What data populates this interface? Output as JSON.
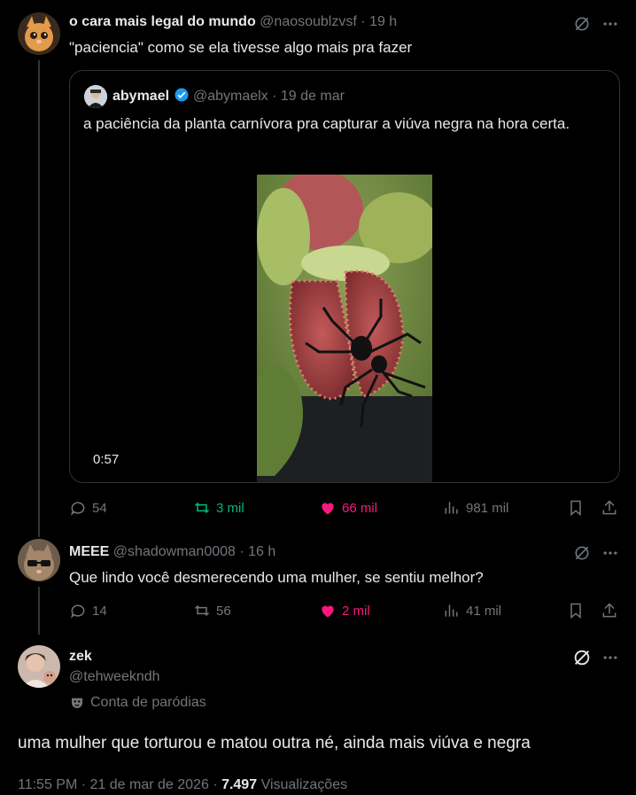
{
  "post1": {
    "display_name": "o cara mais legal do mundo",
    "handle": "@naosoublzvsf",
    "time": "· 19 h",
    "text": "\"paciencia\" como se ela tivesse algo mais pra fazer",
    "quote": {
      "display_name": "abymael",
      "handle": "@abymaelx",
      "time": "· 19 de mar",
      "text": "a paciência da planta carnívora pra capturar a viúva negra na hora certa.",
      "video_duration": "0:57"
    },
    "stats": {
      "replies": "54",
      "reposts": "3 mil",
      "likes": "66 mil",
      "views": "981 mil"
    }
  },
  "post2": {
    "display_name": "MEEE",
    "handle": "@shadowman0008",
    "time": "· 16 h",
    "text": "Que lindo você desmerecendo uma mulher, se sentiu melhor?",
    "stats": {
      "replies": "14",
      "reposts": "56",
      "likes": "2 mil",
      "views": "41 mil"
    }
  },
  "post3": {
    "display_name": "zek",
    "handle": "@tehweekndh",
    "parody_label": "Conta de paródias",
    "text": "uma mulher que torturou e matou outra né, ainda mais viúva e negra",
    "timestamp": "11:55 PM · 21 de mar de 2026 ·",
    "views_count": "7.497",
    "views_label": "Visualizações"
  },
  "colors": {
    "background": "#000000",
    "text": "#e7e9ea",
    "muted": "#71767b",
    "repost_active": "#00ba7c",
    "like_active": "#f91880",
    "verified": "#1d9bf0",
    "border": "#2f3336"
  }
}
